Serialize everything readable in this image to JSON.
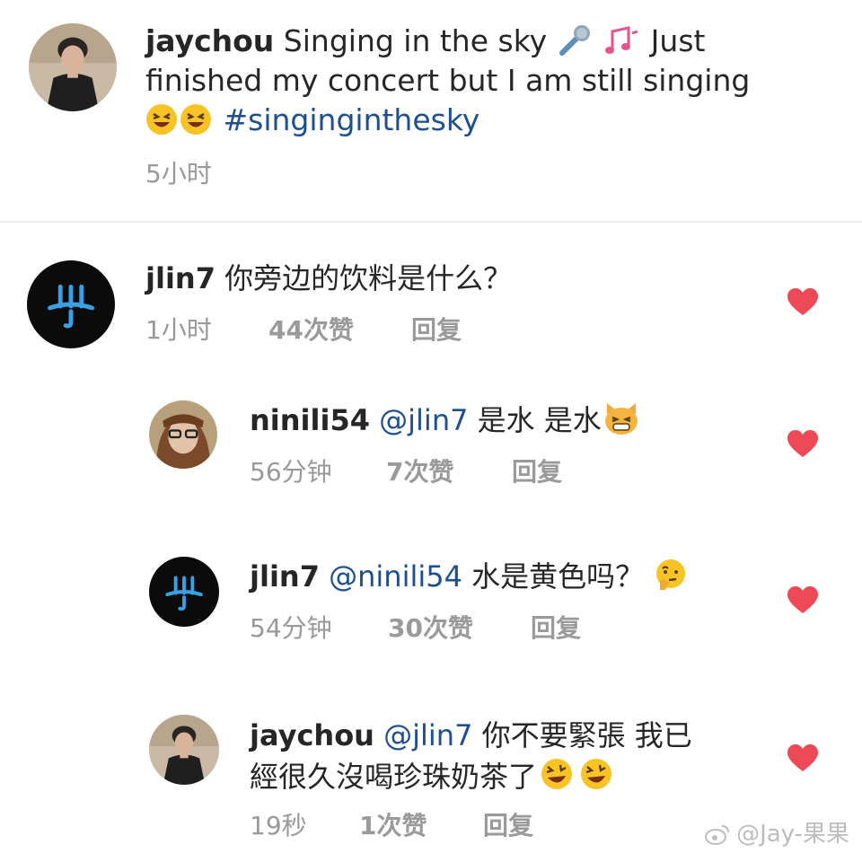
{
  "post": {
    "username": "jaychou",
    "caption_part1": "Singing in the sky",
    "caption_part2": "Just",
    "caption_line2": "finished my concert but I am still singing",
    "hashtag": "#singinginthesky",
    "time": "5小时"
  },
  "comments": [
    {
      "username": "jlin7",
      "text": "你旁边的饮料是什么？",
      "time": "1小时",
      "likes": "44次赞",
      "reply": "回复"
    },
    {
      "username": "ninili54",
      "mention": "@jlin7",
      "text": "是水 是水",
      "time": "56分钟",
      "likes": "7次赞",
      "reply": "回复"
    },
    {
      "username": "jlin7",
      "mention": "@ninili54",
      "text": "水是黄色吗？",
      "time": "54分钟",
      "likes": "30次赞",
      "reply": "回复"
    },
    {
      "username": "jaychou",
      "mention": "@jlin7",
      "text_line1": "你不要緊張 我已",
      "text_line2": "經很久沒喝珍珠奶茶了",
      "time": "19秒",
      "likes": "1次赞",
      "reply": "回复"
    }
  ],
  "watermark": "@Jay-果果",
  "colors": {
    "heart": "#ed4956",
    "link": "#1f4f8f",
    "meta": "#999999"
  },
  "icons": [
    "microphone-icon",
    "music-notes-icon",
    "laughing-emoji-icon",
    "grinning-cat-emoji-icon",
    "thinking-emoji-icon",
    "rofl-emoji-icon",
    "heart-icon",
    "weibo-icon"
  ]
}
